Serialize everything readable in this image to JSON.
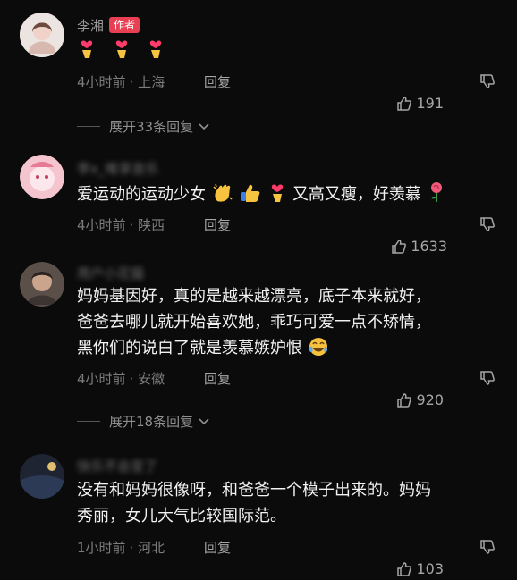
{
  "comments": [
    {
      "username": "李湘",
      "badge": "作者",
      "text": "",
      "time": "4小时前",
      "location": "上海",
      "reply_label": "回复",
      "likes": "191",
      "expand": "展开33条回复"
    },
    {
      "username": "李x_唯享音乐",
      "text_a": "爱运动的运动少女",
      "text_b": "又高又瘦，好羡慕",
      "time": "4小时前",
      "location": "陕西",
      "reply_label": "回复",
      "likes": "1633"
    },
    {
      "username": "用户小花猫",
      "lines": [
        "妈妈基因好，真的是越来越漂亮，底子本来就好，",
        "爸爸去哪儿就开始喜欢她，乖巧可爱一点不矫情，",
        "黑你们的说白了就是羡慕嫉妒恨"
      ],
      "time": "4小时前",
      "location": "安徽",
      "reply_label": "回复",
      "likes": "920",
      "expand": "展开18条回复"
    },
    {
      "username": "快乐不会变了",
      "lines": [
        "没有和妈妈很像呀，和爸爸一个模子出来的。妈妈",
        "秀丽，女儿大气比较国际范。"
      ],
      "time": "1小时前",
      "location": "河北",
      "reply_label": "回复",
      "likes": "103"
    }
  ],
  "colors": {
    "background": "#0b0b0c",
    "author_badge": "#e83f52"
  },
  "icons": [
    "heart-hands-emoji",
    "clap-emoji",
    "thumbs-up-emoji",
    "rose-emoji",
    "tears-of-joy-emoji",
    "like-icon",
    "dislike-icon",
    "chevron-down-icon"
  ]
}
